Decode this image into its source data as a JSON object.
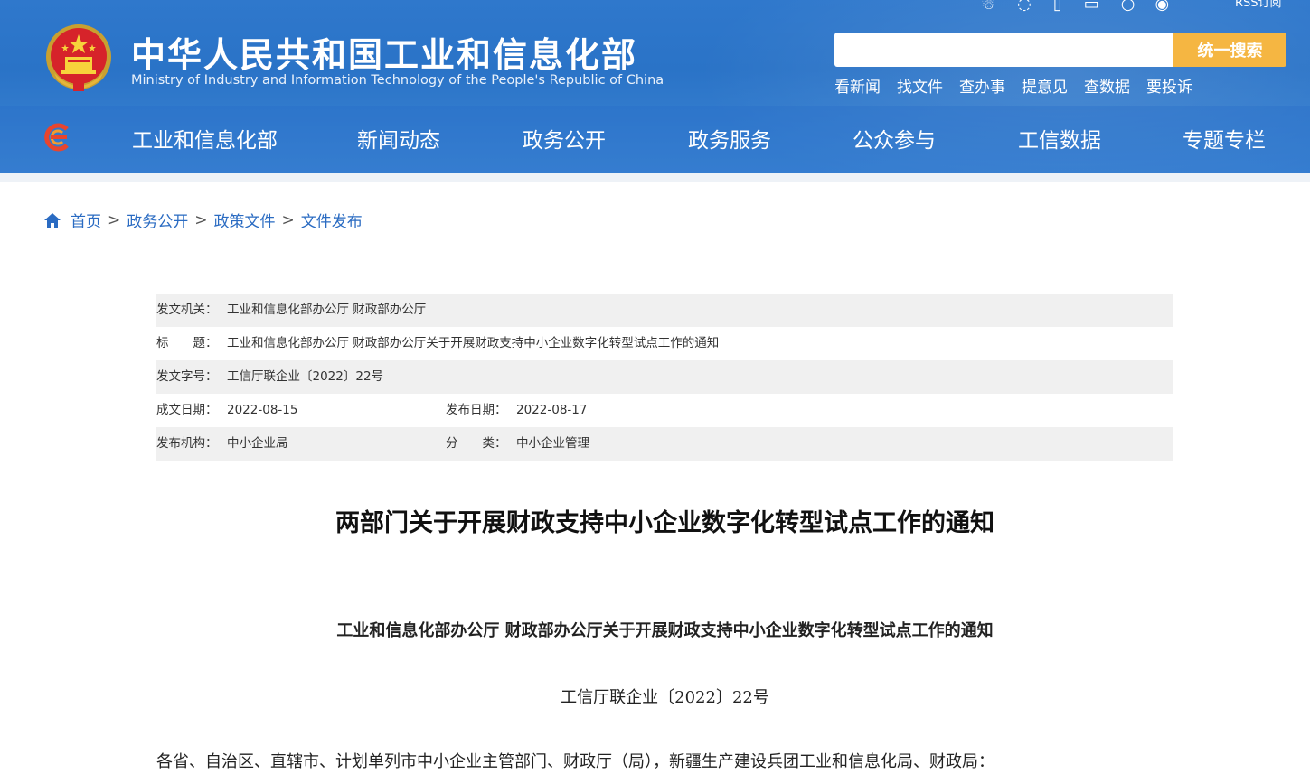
{
  "header": {
    "title": "中华人民共和国工业和信息化部",
    "subtitle": "Ministry of Industry and Information Technology of the People's Republic of China",
    "rss_label": "RSS订阅",
    "top_icons": [
      "accessibility-icon",
      "language-icon",
      "mobile-icon",
      "tv-icon",
      "wechat-icon",
      "weibo-icon"
    ]
  },
  "search": {
    "placeholder": "",
    "button_label": "统一搜索"
  },
  "quick_links": [
    "看新闻",
    "找文件",
    "查办事",
    "提意见",
    "查数据",
    "要投诉"
  ],
  "nav": [
    "工业和信息化部",
    "新闻动态",
    "政务公开",
    "政务服务",
    "公众参与",
    "工信数据",
    "专题专栏"
  ],
  "breadcrumb": [
    "首页",
    "政务公开",
    "政策文件",
    "文件发布"
  ],
  "meta": {
    "issuer_label": "发文机关：",
    "issuer": "工业和信息化部办公厅 财政部办公厅",
    "title_label": "标　　题：",
    "title": "工业和信息化部办公厅 财政部办公厅关于开展财政支持中小企业数字化转型试点工作的通知",
    "doc_no_label": "发文字号：",
    "doc_no": "工信厅联企业〔2022〕22号",
    "written_date_label": "成文日期：",
    "written_date": "2022-08-15",
    "publish_date_label": "发布日期：",
    "publish_date": "2022-08-17",
    "org_label": "发布机构：",
    "org": "中小企业局",
    "category_label": "分　　类：",
    "category": "中小企业管理"
  },
  "document": {
    "title": "两部门关于开展财政支持中小企业数字化转型试点工作的通知",
    "heading": "工业和信息化部办公厅 财政部办公厅关于开展财政支持中小企业数字化转型试点工作的通知",
    "number": "工信厅联企业〔2022〕22号",
    "recipients": "各省、自治区、直辖市、计划单列市中小企业主管部门、财政厅（局），新疆生产建设兵团工业和信息化局、财政局："
  },
  "colors": {
    "header_blue": "#2f78cc",
    "search_button": "#f5b642",
    "link_blue": "#2a6bc2",
    "meta_row_gray": "#f0f0f0"
  }
}
